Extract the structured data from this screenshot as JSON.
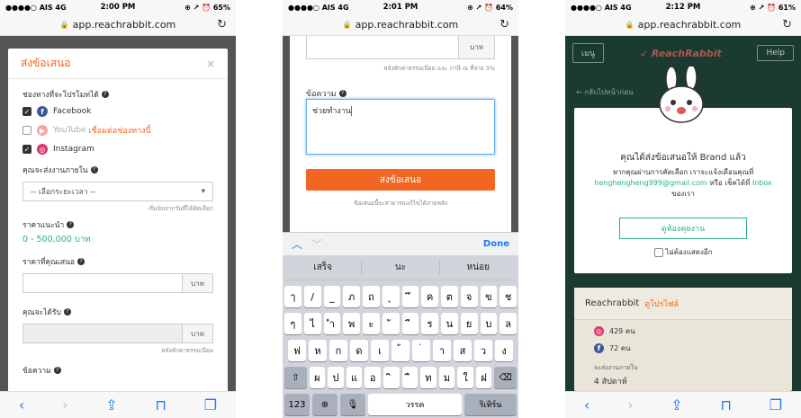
{
  "common": {
    "carrier": "●●●●○ AIS  4G",
    "url": "app.reachrabbit.com"
  },
  "phone1": {
    "time": "2:00 PM",
    "status_right": "⊕ ↗ ⏰ 65%",
    "modal_title": "ส่งข้อเสนอ",
    "channels_label": "ช่องทางที่จะโปรโมทได้",
    "facebook": "Facebook",
    "youtube": "YouTube",
    "youtube_connect": "เชื่อมต่อช่องทางนี้",
    "instagram": "Instagram",
    "timeframe_label": "คุณจะส่งงานภายใน",
    "timeframe_select": "-- เลือกระยะเวลา --",
    "timeframe_hint": "เริ่มนับจากวันที่ได้คัดเลือก",
    "suggested_price_label": "ราคาแนะนำ",
    "suggested_price": "0 - 500,000 บาท",
    "your_price_label": "ราคาที่คุณเสนอ",
    "currency": "บาท",
    "receive_label": "คุณจะได้รับ",
    "fee_hint": "หลังหักค่าธรรมเนียม",
    "message_label": "ข้อความ"
  },
  "phone2": {
    "time": "2:01 PM",
    "status_right": "⊕ ↗ ⏰ 64%",
    "currency": "บาท",
    "fee_hint": "หลังหักค่าธรรมเนียม และ ภาษี ณ ที่จ่าย 3%",
    "message_label": "ข้อความ",
    "message_value": "ช่วยทำงาน",
    "submit": "ส่งข้อเสนอ",
    "note": "ข้อเสนอนี้จะสามารถแก้ไขได้ภายหลัง",
    "done": "Done",
    "suggestions": [
      "เสร็จ",
      "นะ",
      "หน่อย"
    ],
    "row1": [
      "ๅ",
      "/",
      "_",
      "ภ",
      "ถ",
      "ุ",
      "ึ",
      "ค",
      "ต",
      "จ",
      "ข",
      "ช"
    ],
    "row2": [
      "ๆ",
      "ไ",
      "ำ",
      "พ",
      "ะ",
      "ั",
      "ี",
      "ร",
      "น",
      "ย",
      "บ",
      "ล"
    ],
    "row3": [
      "ฟ",
      "ห",
      "ก",
      "ด",
      "เ",
      "้",
      "่",
      "า",
      "ส",
      "ว",
      "ง"
    ],
    "row4": [
      "ผ",
      "ป",
      "แ",
      "อ",
      "ิ",
      "ื",
      "ท",
      "ม",
      "ใ",
      "ฝ"
    ],
    "key_123": "123",
    "space": "วรรค",
    "return": "ริเทิร์น"
  },
  "phone3": {
    "time": "2:12 PM",
    "status_right": "⊕ ↗ ⏰ 61%",
    "menu": "เมนู",
    "logo": "ReachRabbit",
    "help": "Help",
    "back": "← กลับไปหน้าก่อน",
    "title": "คุณได้ส่งข้อเสนอให้ Brand แล้ว",
    "msg1": "หากคุณผ่านการคัดเลือก เราจะแจ้งเตือนคุณที่",
    "email": "henghengheng999@gmail.com",
    "msg2": " หรือ เช็คได้ที่ ",
    "inbox": "Inbox",
    "msg3": "ของเรา",
    "view_button": "ดูห้องคุยงาน",
    "dont_show": "ไม่ต้องแสดงอีก",
    "profile_name": "Reachrabbit",
    "profile_link": "ดูโปรไฟล์",
    "ig_count": "429 คน",
    "fb_count": "72 คน",
    "deliver_label": "จะส่งงานภายใน",
    "deliver_value": "4 สัปดาห์"
  }
}
